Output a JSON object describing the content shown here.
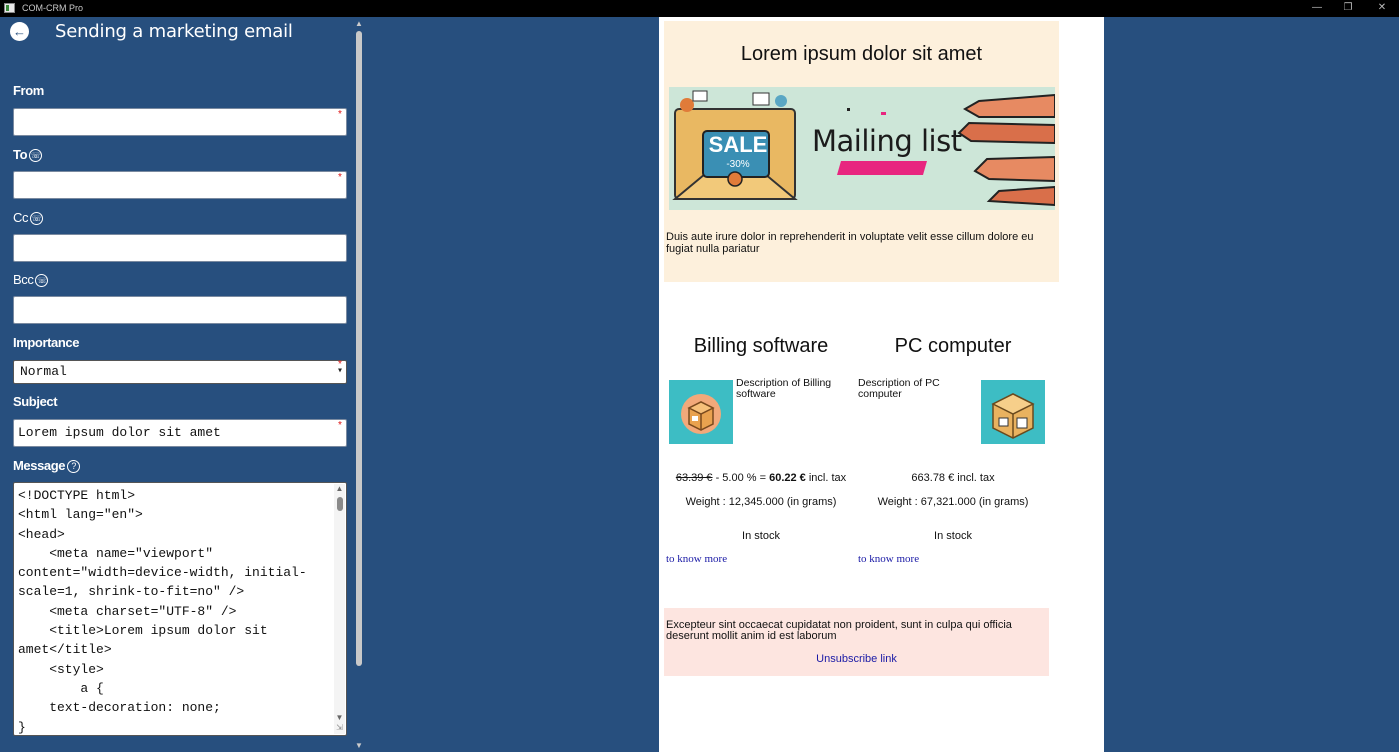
{
  "window": {
    "title": "COM-CRM Pro",
    "minimize": "—",
    "restore": "❐",
    "close": "✕"
  },
  "panel": {
    "back_icon": "←",
    "title": "Sending a marketing email",
    "from_label": "From",
    "from_value": "",
    "to_label": "To",
    "to_value": "",
    "cc_label": "Cc",
    "cc_value": "",
    "bcc_label": "Bcc",
    "bcc_value": "",
    "contacts_icon": "☏",
    "importance_label": "Importance",
    "importance_value": "Normal",
    "subject_label": "Subject",
    "subject_value": "Lorem ipsum dolor sit amet",
    "message_label": "Message",
    "help_icon": "?",
    "required_mark": "*",
    "message_lines": [
      "<!DOCTYPE html>",
      "<html lang=\"en\">",
      "<head>",
      "    <meta name=\"viewport\"",
      "content=\"width=device-width, initial-",
      "scale=1, shrink-to-fit=no\" />",
      "    <meta charset=\"UTF-8\" />",
      "    <title>Lorem ipsum dolor sit",
      "amet</title>",
      "    <style>",
      "        a {",
      "    text-decoration: none;",
      "}"
    ]
  },
  "preview": {
    "hero_title": "Lorem ipsum dolor sit amet",
    "banner_text": "Mailing list",
    "banner_sale": "SALE",
    "banner_discount": "-30%",
    "hero_paragraph": "Duis aute irure dolor in reprehenderit in voluptate velit esse cillum dolore eu fugiat nulla pariatur",
    "products": [
      {
        "title": "Billing software",
        "description": "Description of Billing software",
        "old_price": "63.39 €",
        "discount": " - 5.00 % = ",
        "price": "60.22 €",
        "tax_note": " incl. tax",
        "weight": "Weight : 12,345.000 (in grams)",
        "stock": "In stock",
        "link": "to know more"
      },
      {
        "title": "PC computer",
        "description": "Description of PC computer",
        "price_line": "663.78 € incl. tax",
        "weight": "Weight : 67,321.000 (in grams)",
        "stock": "In stock",
        "link": "to know more"
      }
    ],
    "footer_paragraph": "Excepteur sint occaecat cupidatat non proident, sunt in culpa qui officia deserunt mollit anim id est laborum",
    "unsubscribe": "Unsubscribe link"
  },
  "colors": {
    "app_background": "#274f7e",
    "hero_background": "#fdf0dc",
    "footer_background": "#fde5e0",
    "link": "#1a1aa6"
  }
}
